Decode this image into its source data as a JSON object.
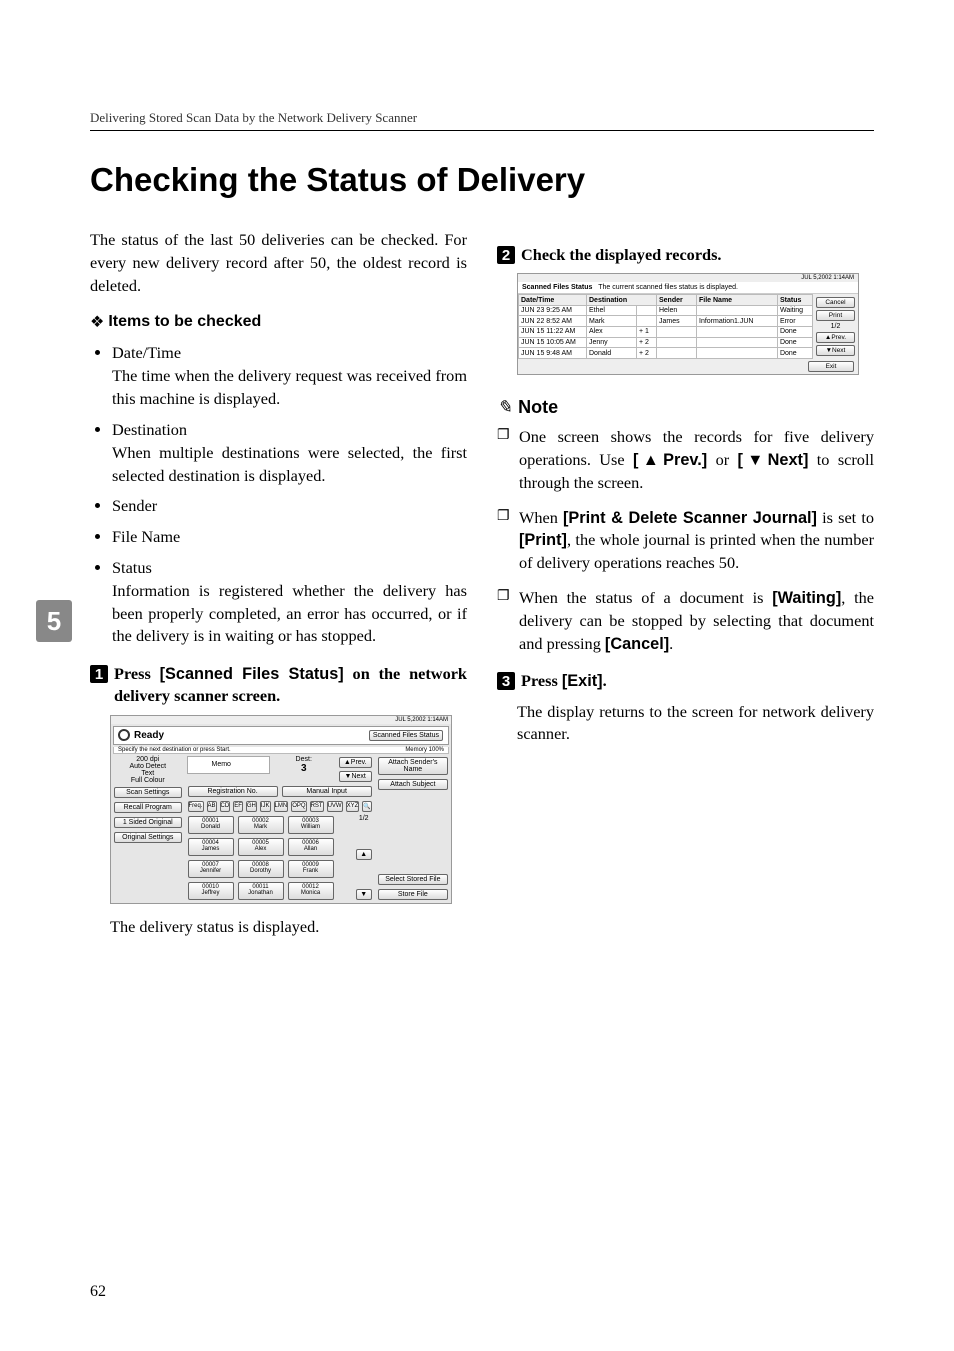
{
  "header": {
    "breadcrumb": "Delivering Stored Scan Data by the Network Delivery Scanner"
  },
  "title": "Checking the Status of Delivery",
  "intro": "The status of the last 50 deliveries can be checked. For every new delivery record after 50, the oldest record is deleted.",
  "items_heading": "Items to be checked",
  "items": [
    {
      "label": "Date/Time",
      "desc": "The time when the delivery request was received from this machine is displayed."
    },
    {
      "label": "Destination",
      "desc": "When multiple destinations were selected, the first selected destination is displayed."
    },
    {
      "label": "Sender",
      "desc": ""
    },
    {
      "label": "File Name",
      "desc": ""
    },
    {
      "label": "Status",
      "desc": "Information is registered whether the delivery has been properly completed, an error has occurred, or if the delivery is in waiting or has stopped."
    }
  ],
  "step1": {
    "num": "1",
    "prefix": "Press ",
    "bold": "[Scanned Files Status]",
    "suffix": " on the network delivery scanner screen."
  },
  "after_step1": "The delivery status is displayed.",
  "step2": {
    "num": "2",
    "text": "Check the displayed records."
  },
  "note_label": "Note",
  "notes": [
    {
      "t1": "One screen shows the records for five delivery operations. Use ",
      "b1": "[▲Prev.]",
      "t2": " or ",
      "b2": "[▼Next]",
      "t3": " to scroll through the screen."
    },
    {
      "t1": "When ",
      "b1": "[Print & Delete Scanner Journal]",
      "t2": " is set to ",
      "b2": "[Print]",
      "t3": ", the whole journal is printed when the number of delivery operations reaches 50."
    },
    {
      "t1": "When the status of a document is ",
      "b1": "[Waiting]",
      "t2": ", the delivery can be stopped by selecting that document and pressing ",
      "b2": "[Cancel]",
      "t3": "."
    }
  ],
  "step3": {
    "num": "3",
    "prefix": "Press ",
    "bold": "[Exit]",
    "suffix": "."
  },
  "after_step3": "The display returns to the screen for network delivery scanner.",
  "sidenum": "5",
  "pagenum": "62",
  "shot1": {
    "datetime": "JUL   5,2002  1:14AM",
    "ready_label": "Ready",
    "ready_hint": "Specify the next destination or press Start.",
    "scanned_status_btn": "Scanned Files Status",
    "memory_label": "Memory 100%",
    "attach_sender": "Attach Sender's Name",
    "attach_subject": "Attach Subject",
    "select_stored": "Select Stored File",
    "store_file": "Store File",
    "left": {
      "dpi": "200 dpi",
      "auto": "Auto Detect",
      "text": "Text",
      "full": "Full Colour",
      "scan": "Scan Settings",
      "recall": "Recall Program",
      "sided": "1 Sided Original",
      "orig": "Original Settings"
    },
    "dest_label": "Dest:",
    "dest_count": "3",
    "prev": "▲Prev.",
    "next": "▼Next",
    "registration": "Registration No.",
    "manual_input": "Manual Input",
    "search_icon": "🔍",
    "memo": "Memo",
    "page_ind": "1/2",
    "tabs": [
      "Freq.",
      "AB",
      "CD",
      "EF",
      "GH",
      "IJK",
      "LMN",
      "OPQ",
      "RST",
      "UVW",
      "XYZ"
    ],
    "cells": [
      [
        "00001",
        "Donald"
      ],
      [
        "00002",
        "Mark"
      ],
      [
        "00003",
        "William"
      ],
      [
        "00004",
        "James"
      ],
      [
        "00005",
        "Alex"
      ],
      [
        "00006",
        "Allan"
      ],
      [
        "00007",
        "Jennifer"
      ],
      [
        "00008",
        "Dorothy"
      ],
      [
        "00009",
        "Frank"
      ],
      [
        "00010",
        "Jeffrey"
      ],
      [
        "00011",
        "Jonathan"
      ],
      [
        "00012",
        "Monica"
      ]
    ]
  },
  "shot2": {
    "datetime": "JUL   5,2002  1:14AM",
    "title_left": "Scanned Files Status",
    "title_right": "The current scanned files status is displayed.",
    "headers": [
      "Date/Time",
      "Destination",
      "Sender",
      "File Name",
      "Status"
    ],
    "rows": [
      [
        "JUN 23   9:25 AM",
        "Ethel",
        "",
        "Helen",
        "",
        "Waiting"
      ],
      [
        "JUN 22   8:52 AM",
        "Mark",
        "",
        "James",
        "Information1.JUN",
        "Error"
      ],
      [
        "JUN 15  11:22 AM",
        "Alex",
        "+  1",
        "",
        "",
        "Done"
      ],
      [
        "JUN 15  10:05 AM",
        "Jenny",
        "+  2",
        "",
        "",
        "Done"
      ],
      [
        "JUN 15   9:48 AM",
        "Donald",
        "+  2",
        "",
        "",
        "Done"
      ]
    ],
    "cancel": "Cancel",
    "print": "Print",
    "page": "1/2",
    "prev": "▲Prev.",
    "next": "▼Next",
    "exit": "Exit"
  }
}
